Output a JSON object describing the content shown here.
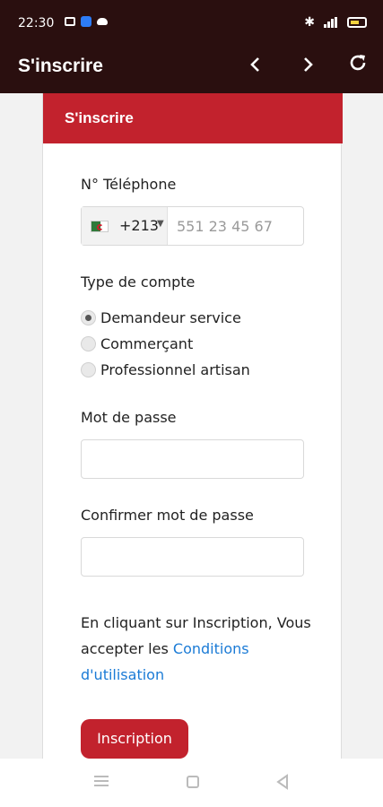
{
  "status_bar": {
    "time": "22:30",
    "icons": [
      "notification-icon",
      "app-icon",
      "cloud-icon",
      "bluetooth-icon",
      "signal-icon",
      "battery-icon"
    ]
  },
  "app_bar": {
    "title": "S'inscrire",
    "back_icon": "chevron-left-icon",
    "forward_icon": "chevron-right-icon",
    "refresh_icon": "refresh-icon"
  },
  "form": {
    "header": "S'inscrire",
    "phone_label": "N° Téléphone",
    "dial_code": "+213",
    "phone_placeholder": "551 23 45 67",
    "account_type_label": "Type de compte",
    "account_types": [
      {
        "label": "Demandeur service",
        "checked": true
      },
      {
        "label": "Commerçant",
        "checked": false
      },
      {
        "label": "Professionnel artisan",
        "checked": false
      }
    ],
    "password_label": "Mot de passe",
    "confirm_password_label": "Confirmer mot de passe",
    "terms_prefix": "En cliquant sur Inscription, Vous accepter les ",
    "terms_link": "Conditions d'utilisation",
    "submit_label": "Inscription"
  },
  "colors": {
    "header_bg": "#2a0f0f",
    "accent": "#c2222d",
    "link": "#1b7bd6"
  }
}
